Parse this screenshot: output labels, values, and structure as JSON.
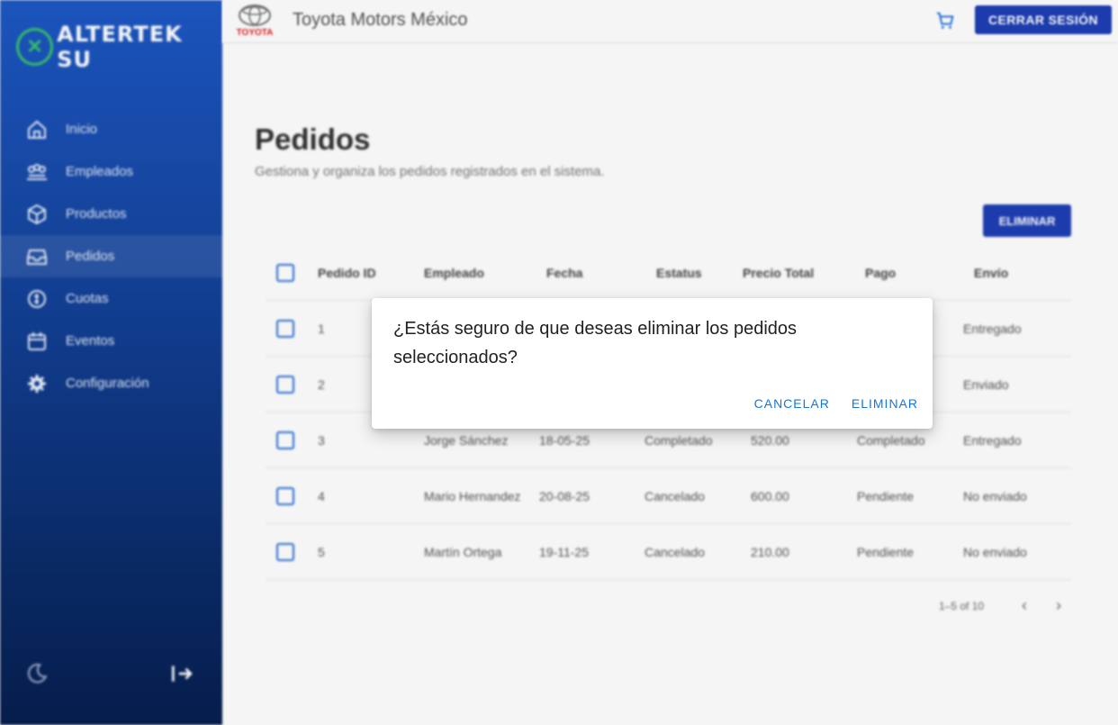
{
  "sidebar": {
    "logo_text": "ALTERTEK SU",
    "items": [
      {
        "label": "Inicio",
        "icon": "home-icon"
      },
      {
        "label": "Empleados",
        "icon": "people-icon"
      },
      {
        "label": "Productos",
        "icon": "box-icon"
      },
      {
        "label": "Pedidos",
        "icon": "inbox-icon",
        "active": true
      },
      {
        "label": "Cuotas",
        "icon": "money-icon"
      },
      {
        "label": "Eventos",
        "icon": "calendar-icon"
      },
      {
        "label": "Configuración",
        "icon": "gear-icon"
      }
    ]
  },
  "header": {
    "brand_logo_text": "TOYOTA",
    "brand_name": "Toyota Motors México",
    "logout_label": "CERRAR SESIÓN"
  },
  "main": {
    "title": "Pedidos",
    "subtitle": "Gestiona y organiza los pedidos registrados en el sistema.",
    "delete_label": "ELIMINAR",
    "columns": [
      "Pedido ID",
      "Empleado",
      "Fecha",
      "Estatus",
      "Precio Total",
      "Pago",
      "Envío"
    ],
    "rows": [
      {
        "id": "1",
        "empleado": "",
        "fecha": "",
        "estatus": "",
        "precio": "",
        "pago": "",
        "envio": "Entregado"
      },
      {
        "id": "2",
        "empleado": "",
        "fecha": "",
        "estatus": "",
        "precio": "",
        "pago": "",
        "envio": "Enviado"
      },
      {
        "id": "3",
        "empleado": "Jorge Sánchez",
        "fecha": "18-05-25",
        "estatus": "Completado",
        "precio": "520.00",
        "pago": "Completado",
        "envio": "Entregado"
      },
      {
        "id": "4",
        "empleado": "Mario Hernandez",
        "fecha": "20-08-25",
        "estatus": "Cancelado",
        "precio": "600.00",
        "pago": "Pendiente",
        "envio": "No enviado"
      },
      {
        "id": "5",
        "empleado": "Martín Ortega",
        "fecha": "19-11-25",
        "estatus": "Cancelado",
        "precio": "210.00",
        "pago": "Pendiente",
        "envio": "No enviado"
      }
    ],
    "pagination": "1–5 of 10"
  },
  "dialog": {
    "message": "¿Estás seguro de que deseas eliminar los pedidos seleccionados?",
    "cancel_label": "CANCELAR",
    "confirm_label": "ELIMINAR"
  },
  "colors": {
    "primary": "#1e3fb5",
    "sidebar_top": "#1d58c4",
    "sidebar_bottom": "#071f4f",
    "dialog_action": "#1976d2",
    "checkbox": "#2a6fd8"
  }
}
